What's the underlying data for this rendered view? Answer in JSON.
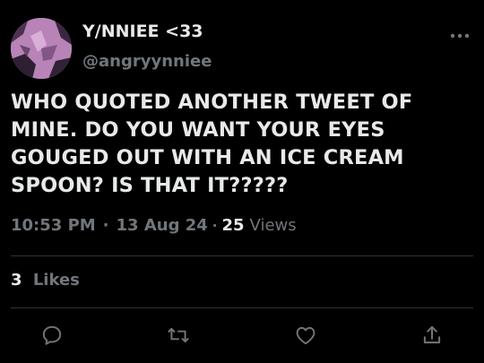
{
  "author": {
    "display_name": "Y/NNIEE <33",
    "handle": "@angryynniee"
  },
  "tweet": {
    "text": "WHO QUOTED ANOTHER TWEET OF\nMINE. DO YOU WANT YOUR EYES\nGOUGED OUT WITH AN ICE CREAM\nSPOON? IS THAT IT?????",
    "time": "10:53 PM",
    "date": "13 Aug 24",
    "views_count": "25",
    "views_label": "Views"
  },
  "engagement": {
    "likes_count": "3",
    "likes_label": "Likes"
  },
  "icons": {
    "more": "more-horizontal-icon",
    "reply": "reply-icon",
    "retweet": "retweet-icon",
    "like": "heart-icon",
    "share": "share-icon"
  },
  "colors": {
    "background": "#000000",
    "primary_text": "#e7e9ea",
    "secondary_text": "#71767b",
    "divider": "#2f3336"
  }
}
